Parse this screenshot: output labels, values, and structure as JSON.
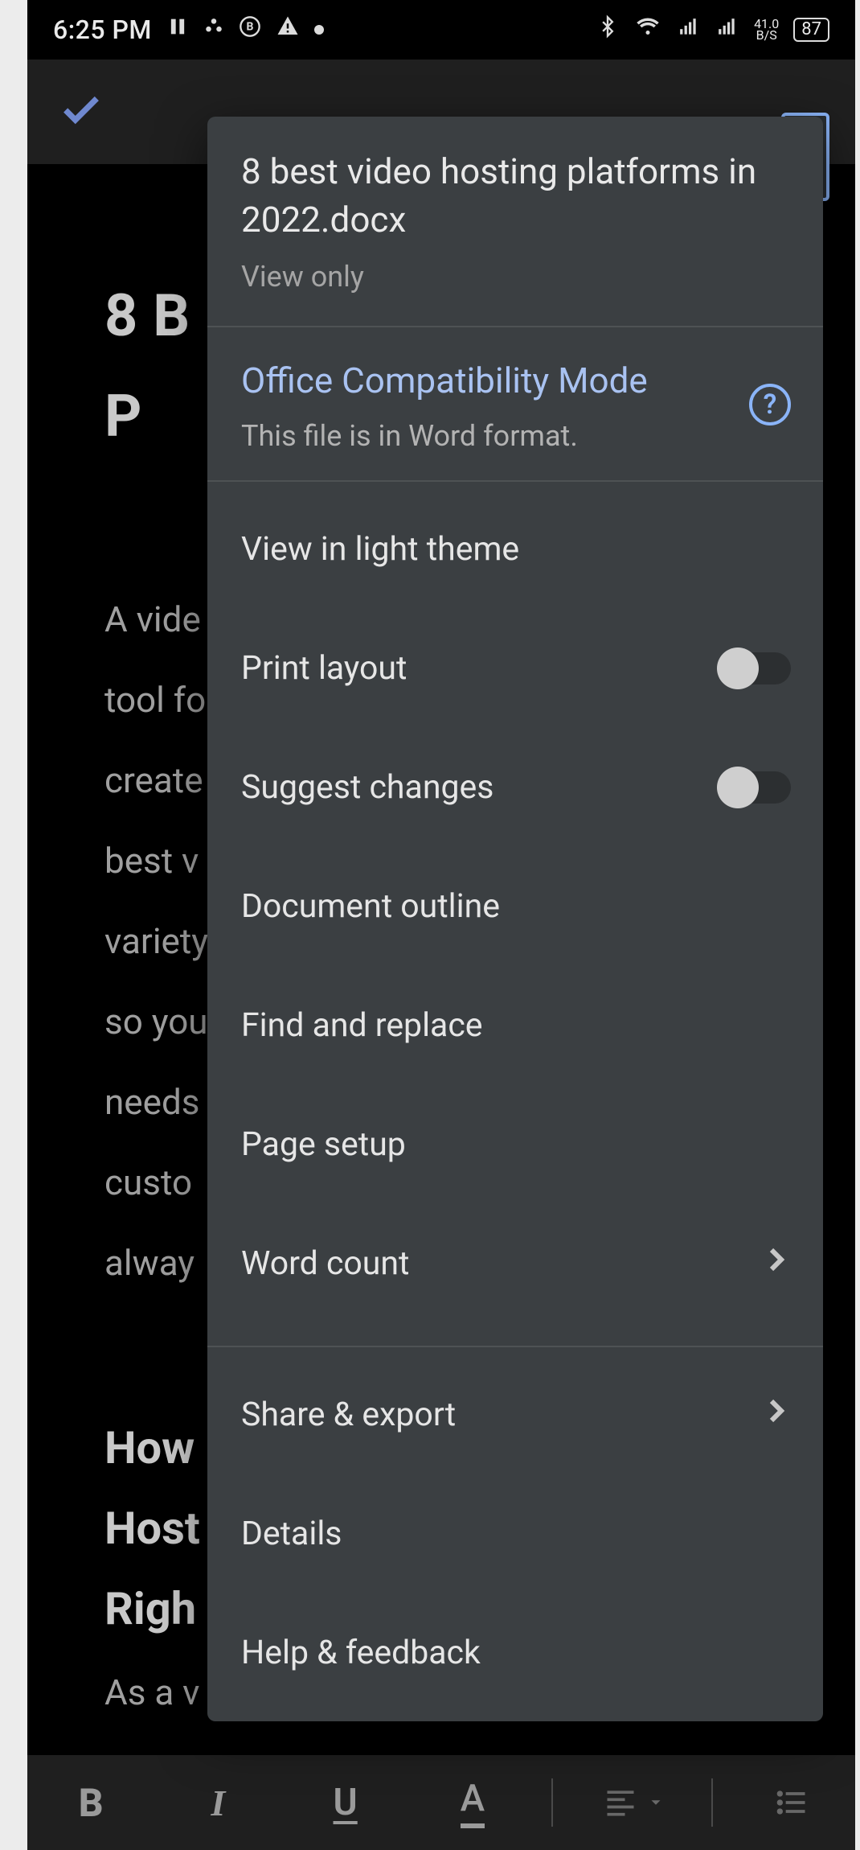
{
  "statusbar": {
    "time": "6:25 PM",
    "net_rate_top": "41.0",
    "net_rate_bottom": "B/S",
    "battery": "87"
  },
  "doc": {
    "heading1": "8 B",
    "heading2": "P",
    "para1": "A vide\ntool fo\ncreate\nbest v\nvariety\nso you\nneeds\ncusto\nalway",
    "h2": "How\nHost\nRigh",
    "para2": "As a v"
  },
  "menu": {
    "header": {
      "title": "8 best video hosting platforms in 2022.docx",
      "subtitle": "View only"
    },
    "compat": {
      "title": "Office Compatibility Mode",
      "subtitle": "This file is in Word format."
    },
    "items_primary": [
      {
        "label": "View in light theme",
        "type": "plain"
      },
      {
        "label": "Print layout",
        "type": "switch",
        "on": false
      },
      {
        "label": "Suggest changes",
        "type": "switch",
        "on": false
      },
      {
        "label": "Document outline",
        "type": "plain"
      },
      {
        "label": "Find and replace",
        "type": "plain"
      },
      {
        "label": "Page setup",
        "type": "plain"
      },
      {
        "label": "Word count",
        "type": "chevron"
      }
    ],
    "items_secondary": [
      {
        "label": "Share & export",
        "type": "chevron"
      },
      {
        "label": "Details",
        "type": "plain"
      },
      {
        "label": "Help & feedback",
        "type": "plain"
      }
    ]
  },
  "toolbar": {
    "bold": "B",
    "italic": "I",
    "underline": "U",
    "textcolor": "A"
  }
}
